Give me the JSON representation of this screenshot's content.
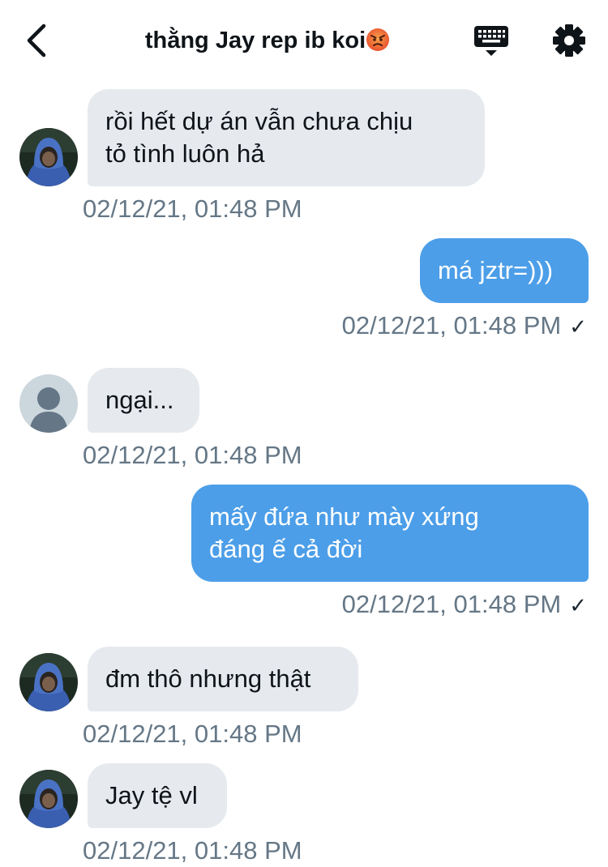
{
  "header": {
    "title": "thằng Jay rep ib koi",
    "title_emoji": "angry-face-emoji",
    "back_icon": "chevron-left-icon",
    "keyboard_icon": "keyboard-icon",
    "settings_icon": "gear-icon"
  },
  "colors": {
    "incoming_bubble": "#e6e9ee",
    "outgoing_bubble": "#4c9ee8",
    "timestamp": "#657786"
  },
  "messages": [
    {
      "direction": "in",
      "avatar": "hooded-person-photo",
      "lines": [
        "rồi hết dự án vẫn chưa chịu",
        "tỏ tình luôn hả"
      ],
      "time": "02/12/21, 01:48 PM"
    },
    {
      "direction": "out",
      "lines": [
        "má jztr=)))"
      ],
      "time": "02/12/21, 01:48 PM",
      "status_icon": "checkmark-icon",
      "status": "✓"
    },
    {
      "direction": "in",
      "avatar": "default-avatar-silhouette",
      "lines": [
        "ngại..."
      ],
      "time": "02/12/21, 01:48 PM"
    },
    {
      "direction": "out",
      "lines": [
        "mấy đứa như mày xứng",
        "đáng ế cả đời"
      ],
      "time": "02/12/21, 01:48 PM",
      "status_icon": "checkmark-icon",
      "status": "✓"
    },
    {
      "direction": "in",
      "avatar": "hooded-person-photo",
      "lines": [
        "đm thô nhưng thật"
      ],
      "time": "02/12/21, 01:48 PM"
    },
    {
      "direction": "in",
      "avatar": "hooded-person-photo",
      "lines": [
        "Jay tệ vl"
      ],
      "time": "02/12/21, 01:48 PM"
    }
  ]
}
